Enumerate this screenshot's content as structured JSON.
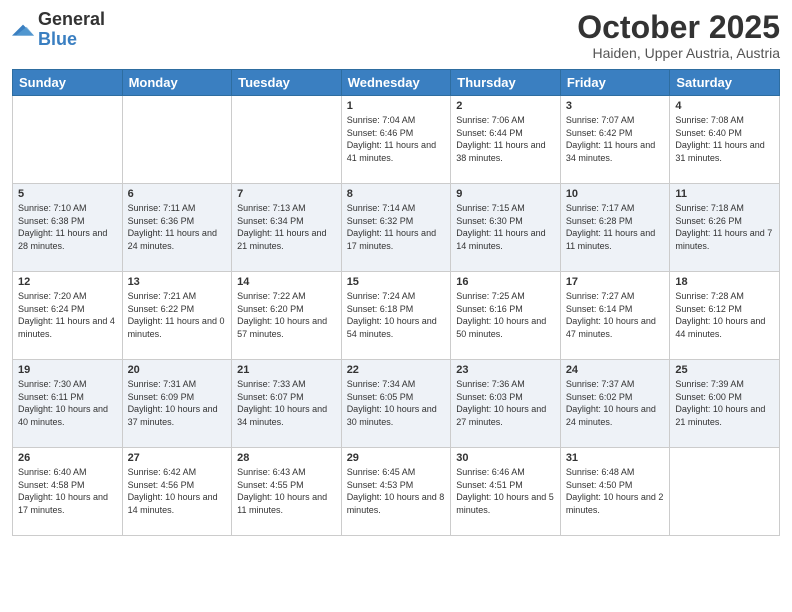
{
  "logo": {
    "general": "General",
    "blue": "Blue"
  },
  "header": {
    "month": "October 2025",
    "location": "Haiden, Upper Austria, Austria"
  },
  "weekdays": [
    "Sunday",
    "Monday",
    "Tuesday",
    "Wednesday",
    "Thursday",
    "Friday",
    "Saturday"
  ],
  "weeks": [
    [
      {
        "day": "",
        "info": ""
      },
      {
        "day": "",
        "info": ""
      },
      {
        "day": "",
        "info": ""
      },
      {
        "day": "1",
        "info": "Sunrise: 7:04 AM\nSunset: 6:46 PM\nDaylight: 11 hours and 41 minutes."
      },
      {
        "day": "2",
        "info": "Sunrise: 7:06 AM\nSunset: 6:44 PM\nDaylight: 11 hours and 38 minutes."
      },
      {
        "day": "3",
        "info": "Sunrise: 7:07 AM\nSunset: 6:42 PM\nDaylight: 11 hours and 34 minutes."
      },
      {
        "day": "4",
        "info": "Sunrise: 7:08 AM\nSunset: 6:40 PM\nDaylight: 11 hours and 31 minutes."
      }
    ],
    [
      {
        "day": "5",
        "info": "Sunrise: 7:10 AM\nSunset: 6:38 PM\nDaylight: 11 hours and 28 minutes."
      },
      {
        "day": "6",
        "info": "Sunrise: 7:11 AM\nSunset: 6:36 PM\nDaylight: 11 hours and 24 minutes."
      },
      {
        "day": "7",
        "info": "Sunrise: 7:13 AM\nSunset: 6:34 PM\nDaylight: 11 hours and 21 minutes."
      },
      {
        "day": "8",
        "info": "Sunrise: 7:14 AM\nSunset: 6:32 PM\nDaylight: 11 hours and 17 minutes."
      },
      {
        "day": "9",
        "info": "Sunrise: 7:15 AM\nSunset: 6:30 PM\nDaylight: 11 hours and 14 minutes."
      },
      {
        "day": "10",
        "info": "Sunrise: 7:17 AM\nSunset: 6:28 PM\nDaylight: 11 hours and 11 minutes."
      },
      {
        "day": "11",
        "info": "Sunrise: 7:18 AM\nSunset: 6:26 PM\nDaylight: 11 hours and 7 minutes."
      }
    ],
    [
      {
        "day": "12",
        "info": "Sunrise: 7:20 AM\nSunset: 6:24 PM\nDaylight: 11 hours and 4 minutes."
      },
      {
        "day": "13",
        "info": "Sunrise: 7:21 AM\nSunset: 6:22 PM\nDaylight: 11 hours and 0 minutes."
      },
      {
        "day": "14",
        "info": "Sunrise: 7:22 AM\nSunset: 6:20 PM\nDaylight: 10 hours and 57 minutes."
      },
      {
        "day": "15",
        "info": "Sunrise: 7:24 AM\nSunset: 6:18 PM\nDaylight: 10 hours and 54 minutes."
      },
      {
        "day": "16",
        "info": "Sunrise: 7:25 AM\nSunset: 6:16 PM\nDaylight: 10 hours and 50 minutes."
      },
      {
        "day": "17",
        "info": "Sunrise: 7:27 AM\nSunset: 6:14 PM\nDaylight: 10 hours and 47 minutes."
      },
      {
        "day": "18",
        "info": "Sunrise: 7:28 AM\nSunset: 6:12 PM\nDaylight: 10 hours and 44 minutes."
      }
    ],
    [
      {
        "day": "19",
        "info": "Sunrise: 7:30 AM\nSunset: 6:11 PM\nDaylight: 10 hours and 40 minutes."
      },
      {
        "day": "20",
        "info": "Sunrise: 7:31 AM\nSunset: 6:09 PM\nDaylight: 10 hours and 37 minutes."
      },
      {
        "day": "21",
        "info": "Sunrise: 7:33 AM\nSunset: 6:07 PM\nDaylight: 10 hours and 34 minutes."
      },
      {
        "day": "22",
        "info": "Sunrise: 7:34 AM\nSunset: 6:05 PM\nDaylight: 10 hours and 30 minutes."
      },
      {
        "day": "23",
        "info": "Sunrise: 7:36 AM\nSunset: 6:03 PM\nDaylight: 10 hours and 27 minutes."
      },
      {
        "day": "24",
        "info": "Sunrise: 7:37 AM\nSunset: 6:02 PM\nDaylight: 10 hours and 24 minutes."
      },
      {
        "day": "25",
        "info": "Sunrise: 7:39 AM\nSunset: 6:00 PM\nDaylight: 10 hours and 21 minutes."
      }
    ],
    [
      {
        "day": "26",
        "info": "Sunrise: 6:40 AM\nSunset: 4:58 PM\nDaylight: 10 hours and 17 minutes."
      },
      {
        "day": "27",
        "info": "Sunrise: 6:42 AM\nSunset: 4:56 PM\nDaylight: 10 hours and 14 minutes."
      },
      {
        "day": "28",
        "info": "Sunrise: 6:43 AM\nSunset: 4:55 PM\nDaylight: 10 hours and 11 minutes."
      },
      {
        "day": "29",
        "info": "Sunrise: 6:45 AM\nSunset: 4:53 PM\nDaylight: 10 hours and 8 minutes."
      },
      {
        "day": "30",
        "info": "Sunrise: 6:46 AM\nSunset: 4:51 PM\nDaylight: 10 hours and 5 minutes."
      },
      {
        "day": "31",
        "info": "Sunrise: 6:48 AM\nSunset: 4:50 PM\nDaylight: 10 hours and 2 minutes."
      },
      {
        "day": "",
        "info": ""
      }
    ]
  ]
}
